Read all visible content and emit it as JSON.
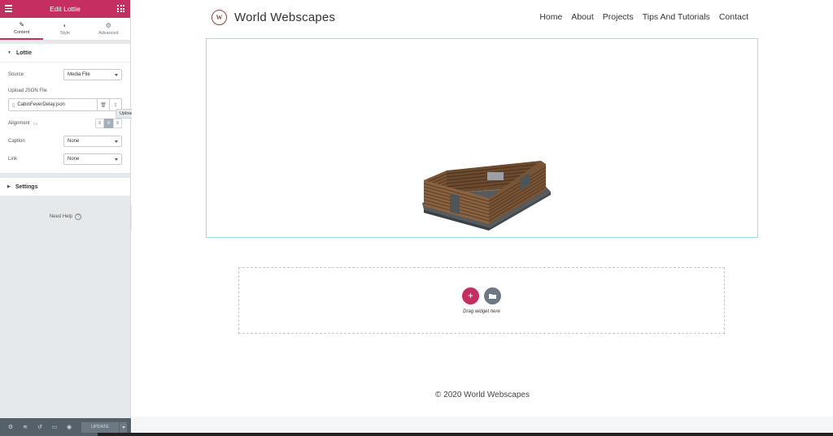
{
  "panel": {
    "title": "Edit Lottie",
    "tabs": [
      {
        "label": "Content",
        "icon": "pencil-icon"
      },
      {
        "label": "Style",
        "icon": "half-circle-icon"
      },
      {
        "label": "Advanced",
        "icon": "gear-icon"
      }
    ],
    "lottie_section": {
      "title": "Lottie",
      "source_label": "Source",
      "source_value": "Media File",
      "upload_label": "Upload JSON File",
      "file_name": "CabinFeverDelay.json",
      "alignment_label": "Alignment",
      "caption_label": "Caption",
      "caption_value": "None",
      "link_label": "Link",
      "link_value": "None"
    },
    "settings_section": {
      "title": "Settings"
    },
    "tooltip": "Upload",
    "need_help": "Need Help",
    "update_label": "UPDATE"
  },
  "site": {
    "logo_text": "W",
    "title": "World Webscapes",
    "nav": [
      "Home",
      "About",
      "Projects",
      "Tips And Tutorials",
      "Contact"
    ],
    "drop_text": "Drag widget here",
    "copyright": "© 2020 World Webscapes"
  },
  "colors": {
    "accent": "#c52e61",
    "panel_bg": "#e6e9ec",
    "footer_bar": "#556068",
    "lottie_border": "#a8dbe6"
  }
}
